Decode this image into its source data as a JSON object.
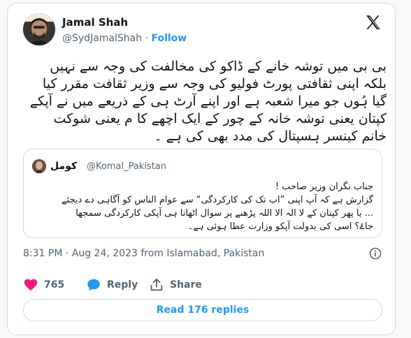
{
  "author": {
    "name": "Jamal Shah",
    "handle": "@SydJamalShah",
    "separator": "·",
    "follow_label": "Follow"
  },
  "tweet": {
    "lines": [
      "بی بی میں توشہ خانے کے ڈاکو کی مخالفت کی وجہ سے نہیں",
      "بلکہ اپنی ثقافتی پورٹ فولیو کی وجہ سے وزیر ثقافت مقرر کیا",
      "گیا ہُوں جو میرا شعبہ ہے اور اپنے آرٹ ہی کے ذریعے میں نے آپکے",
      "کپتان یعنی توشہ خانہ کے چور کے ایک اچھے کا م یعنی شوکت",
      "خانم کینسر ہسپتال کی مدد بھی کی ہے ۔"
    ]
  },
  "quote": {
    "name": "کومل",
    "handle": "@Komal_Pakistan",
    "lines": [
      "جناب نگران وزیر صاحب !",
      "گزارش ہے کہ آپ اپنی ”اب تک کی کارکردگی“ سے عوام الناس کو آگاہی دے دیجئے",
      "... یا پھر کپتان کے لا الہ الا اللہ پڑھنے پر سوال اٹھانا ہی آپکی کارکردگی سمجھا",
      "جاۓ؟ اسی کی بدولت آپکو وزارت عطا ہوئی ہے۔"
    ]
  },
  "meta": {
    "timestamp": "8:31 PM · Aug 24, 2023 from Islamabad, Pakistan"
  },
  "actions": {
    "like_count": "765",
    "reply_label": "Reply",
    "share_label": "Share"
  },
  "replies": {
    "label": "Read 176 replies"
  },
  "colors": {
    "accent": "#1d9bf0",
    "like": "#f91880",
    "text": "#0f1419",
    "muted": "#536471"
  }
}
